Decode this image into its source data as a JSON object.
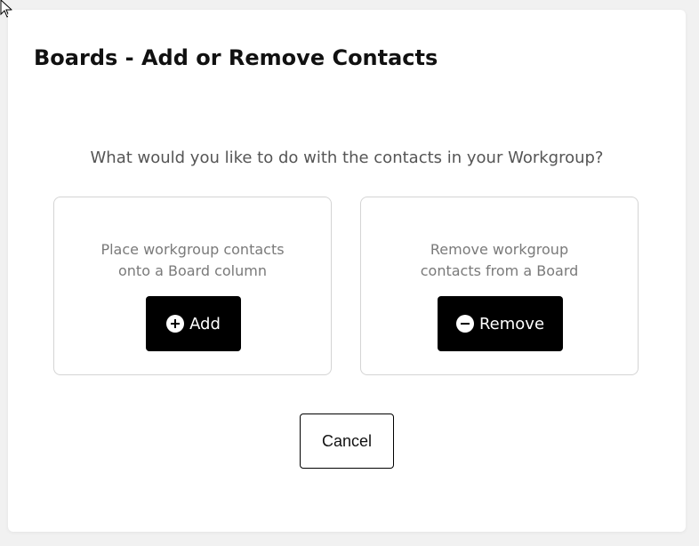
{
  "dialog": {
    "title": "Boards - Add or Remove Contacts",
    "prompt": "What would you like to do with the contacts in your Workgroup?"
  },
  "options": {
    "add": {
      "description_line1": "Place workgroup contacts",
      "description_line2": "onto a Board column",
      "button_label": "Add",
      "icon": "plus-circle-icon"
    },
    "remove": {
      "description_line1": "Remove workgroup",
      "description_line2": "contacts from a Board",
      "button_label": "Remove",
      "icon": "minus-circle-icon"
    }
  },
  "footer": {
    "cancel_label": "Cancel"
  },
  "colors": {
    "primary_button_bg": "#000000",
    "primary_button_text": "#ffffff",
    "card_border": "#d4d4d4",
    "muted_text": "#7a7a7a"
  }
}
